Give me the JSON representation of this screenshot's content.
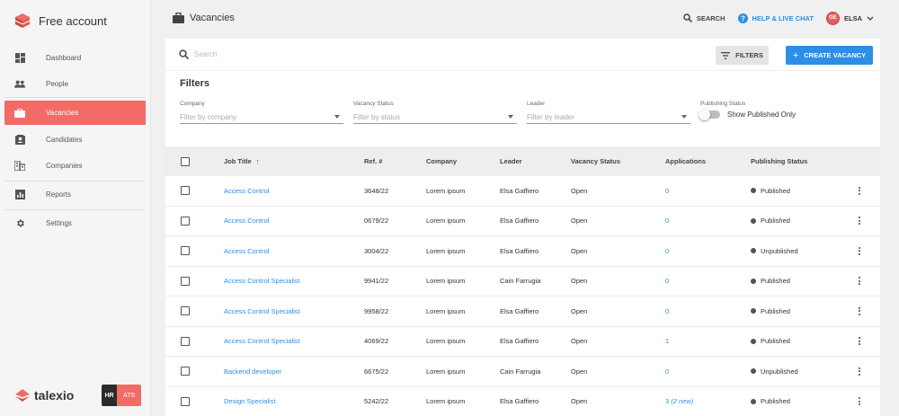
{
  "app": {
    "account_label": "Free account",
    "colors": {
      "accent": "#f26b66",
      "link": "#2d8ee6",
      "sidebar_bg": "#f5f5f5"
    }
  },
  "sidebar": {
    "items": [
      {
        "label": "Dashboard",
        "icon": "dashboard-icon",
        "active": false
      },
      {
        "label": "People",
        "icon": "people-icon",
        "active": false
      },
      {
        "label": "Vacancies",
        "icon": "briefcase-icon",
        "active": true
      },
      {
        "label": "Candidates",
        "icon": "candidate-icon",
        "active": false
      },
      {
        "label": "Companies",
        "icon": "company-icon",
        "active": false
      },
      {
        "label": "Reports",
        "icon": "reports-icon",
        "active": false
      },
      {
        "label": "Settings",
        "icon": "gear-icon",
        "active": false
      }
    ],
    "footer": {
      "brand": "talexio",
      "badge_left": "HR",
      "badge_right": "ATS"
    }
  },
  "header": {
    "title": "Vacancies",
    "search_label": "SEARCH",
    "help_label": "HELP & LIVE CHAT",
    "user_initials": "GE",
    "user_name": "ELSA"
  },
  "toolbar": {
    "search_placeholder": "Search",
    "filters_label": "FILTERS",
    "create_label": "CREATE VACANCY"
  },
  "filters": {
    "title": "Filters",
    "company": {
      "label": "Company",
      "placeholder": "Filter by company"
    },
    "vacancy_status": {
      "label": "Vacancy Status",
      "placeholder": "Filter by status"
    },
    "leader": {
      "label": "Leader",
      "placeholder": "Filter by leader"
    },
    "publishing": {
      "label": "Publishing Status",
      "toggle_label": "Show Published Only",
      "checked": false
    }
  },
  "table": {
    "columns": [
      "Job Title",
      "Ref. #",
      "Company",
      "Leader",
      "Vacancy Status",
      "Applications",
      "Publishing Status"
    ],
    "sort_indicator": "↑",
    "rows": [
      {
        "title": "Access Control",
        "ref": "3648/22",
        "company": "Lorem ipsum",
        "leader": "Elsa Gaffiero",
        "status": "Open",
        "applications": "0",
        "apps_new": "",
        "publishing": "Published"
      },
      {
        "title": "Access Control",
        "ref": "0679/22",
        "company": "Lorem ipsum",
        "leader": "Elsa Gaffiero",
        "status": "Open",
        "applications": "0",
        "apps_new": "",
        "publishing": "Published"
      },
      {
        "title": "Access Control",
        "ref": "3004/22",
        "company": "Lorem ipsum",
        "leader": "Elsa Gaffiero",
        "status": "Open",
        "applications": "0",
        "apps_new": "",
        "publishing": "Unpublished"
      },
      {
        "title": "Access Control Specialist",
        "ref": "9941/22",
        "company": "Lorem ipsum",
        "leader": "Cain Farrugia",
        "status": "Open",
        "applications": "0",
        "apps_new": "",
        "publishing": "Published"
      },
      {
        "title": "Access Control Specialist",
        "ref": "9958/22",
        "company": "Lorem ipsum",
        "leader": "Elsa Gaffiero",
        "status": "Open",
        "applications": "0",
        "apps_new": "",
        "publishing": "Published"
      },
      {
        "title": "Access Control Specialist",
        "ref": "4069/22",
        "company": "Lorem ipsum",
        "leader": "Elsa Gaffiero",
        "status": "Open",
        "applications": "1",
        "apps_new": "",
        "publishing": "Published"
      },
      {
        "title": "Backend developer",
        "ref": "6675/22",
        "company": "Lorem ipsum",
        "leader": "Cain Farrugia",
        "status": "Open",
        "applications": "0",
        "apps_new": "",
        "publishing": "Unpublished"
      },
      {
        "title": "Design Specialist",
        "ref": "5242/22",
        "company": "Lorem ipsum",
        "leader": "Elsa Gaffiero",
        "status": "Open",
        "applications": "3",
        "apps_new": "(2 new)",
        "publishing": "Published"
      }
    ]
  }
}
